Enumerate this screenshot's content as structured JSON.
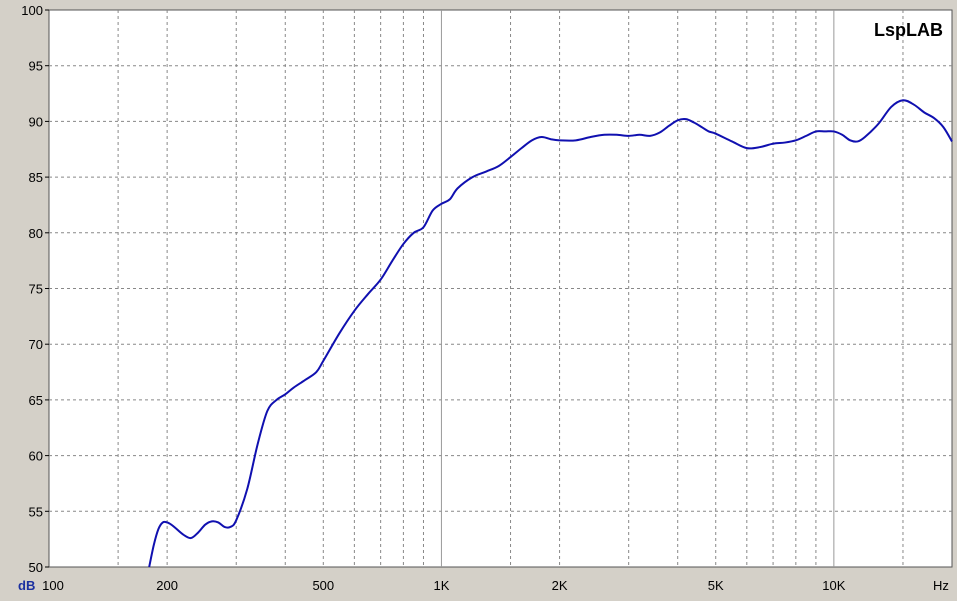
{
  "brand": "LspLAB",
  "colors": {
    "background": "#d4d0c8",
    "plot_bg": "#ffffff",
    "grid": "#888888",
    "major_grid": "#999999",
    "curve": "#1010b0",
    "unit_label": "#1a2fa0"
  },
  "chart_data": {
    "type": "line",
    "title": "",
    "xlabel": "Hz",
    "ylabel": "dB",
    "x_scale": "log",
    "xlim": [
      100,
      20000
    ],
    "ylim": [
      50,
      100
    ],
    "grid": true,
    "y_ticks": [
      50,
      55,
      60,
      65,
      70,
      75,
      80,
      85,
      90,
      95,
      100
    ],
    "x_ticks": [
      {
        "value": 100,
        "label": "100"
      },
      {
        "value": 200,
        "label": "200"
      },
      {
        "value": 500,
        "label": "500"
      },
      {
        "value": 1000,
        "label": "1K"
      },
      {
        "value": 2000,
        "label": "2K"
      },
      {
        "value": 5000,
        "label": "5K"
      },
      {
        "value": 10000,
        "label": "10K"
      }
    ],
    "x_minor_grid": [
      150,
      200,
      300,
      400,
      500,
      600,
      700,
      800,
      900,
      1500,
      2000,
      3000,
      4000,
      5000,
      6000,
      7000,
      8000,
      9000,
      15000
    ],
    "x_major_grid": [
      1000,
      10000
    ],
    "series": [
      {
        "x": [
          180,
          185,
          190,
          195,
          200,
          205,
          210,
          220,
          230,
          240,
          250,
          260,
          270,
          280,
          290,
          300,
          320,
          340,
          360,
          380,
          400,
          420,
          450,
          480,
          500,
          550,
          600,
          650,
          700,
          750,
          800,
          850,
          900,
          950,
          1000,
          1050,
          1100,
          1200,
          1300,
          1400,
          1500,
          1600,
          1700,
          1800,
          1900,
          2000,
          2200,
          2400,
          2600,
          2800,
          3000,
          3200,
          3400,
          3600,
          3800,
          4000,
          4200,
          4400,
          4600,
          4800,
          5000,
          5500,
          6000,
          6500,
          7000,
          7500,
          8000,
          8500,
          9000,
          9500,
          10000,
          10500,
          11000,
          11500,
          12000,
          13000,
          14000,
          15000,
          16000,
          17000,
          18000,
          19000,
          20000
        ],
        "y": [
          50,
          52,
          53.4,
          54,
          54,
          53.8,
          53.5,
          52.9,
          52.6,
          53.1,
          53.8,
          54.1,
          54,
          53.6,
          53.6,
          54.2,
          57,
          61,
          64,
          65,
          65.5,
          66.1,
          66.8,
          67.5,
          68.5,
          71,
          73,
          74.5,
          75.8,
          77.5,
          79,
          80,
          80.5,
          82,
          82.6,
          83,
          84,
          85,
          85.5,
          86,
          86.8,
          87.6,
          88.3,
          88.6,
          88.4,
          88.3,
          88.3,
          88.6,
          88.8,
          88.8,
          88.7,
          88.8,
          88.7,
          89,
          89.6,
          90.1,
          90.2,
          89.9,
          89.5,
          89.1,
          88.9,
          88.2,
          87.6,
          87.7,
          88,
          88.1,
          88.3,
          88.7,
          89.1,
          89.1,
          89.1,
          88.8,
          88.3,
          88.2,
          88.6,
          89.8,
          91.3,
          91.9,
          91.5,
          90.8,
          90.3,
          89.5,
          88.2
        ]
      }
    ]
  }
}
